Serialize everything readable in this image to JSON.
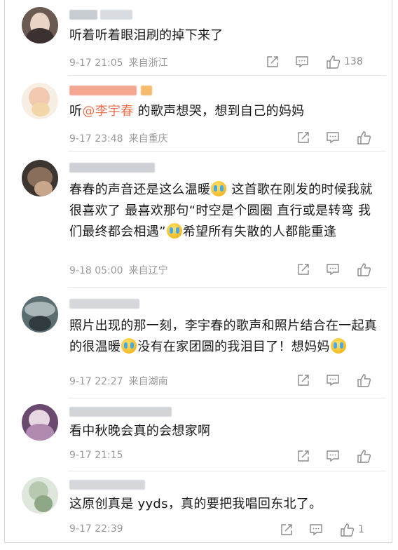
{
  "comments": [
    {
      "text_parts": [
        "听着听着眼泪刷的掉下来了"
      ],
      "date": "9-17 21:05",
      "location": "来自浙江",
      "likes": "138"
    },
    {
      "text_prefix": "听",
      "mention": "@李宇春",
      "text_suffix": " 的歌声想哭，想到自己的妈妈",
      "date": "9-17 23:48",
      "location": "来自重庆",
      "likes": ""
    },
    {
      "text_parts": [
        "春春的声音还是这么温暖",
        " 这首歌在刚发的时候我就很喜欢了 最喜欢那句“时空是个圆圈 直行或是转弯 我们最终都会相遇”",
        "希望所有失散的人都能重逢"
      ],
      "date": "9-18 05:00",
      "location": "来自辽宁",
      "likes": ""
    },
    {
      "text_parts": [
        "照片出现的那一刻，李宇春的歌声和照片结合在一起真的很温暖",
        "没有在家团圆的我泪目了！想妈妈",
        ""
      ],
      "date": "9-17 22:27",
      "location": "来自湖南",
      "likes": ""
    },
    {
      "text_parts": [
        "看中秋晚会真的会想家啊"
      ],
      "date": "9-17 21:15",
      "location": "",
      "likes": ""
    },
    {
      "text_parts": [
        "这原创真是 yyds，真的要把我唱回东北了。"
      ],
      "date": "9-17 22:39",
      "location": "",
      "likes": "1"
    }
  ],
  "icons": {
    "share": "share-icon",
    "comment": "comment-icon",
    "like": "thumbs-up-icon",
    "emoji": "crying-emoji"
  },
  "colors": {
    "mention": "#eb7350",
    "meta": "#9a9a9a",
    "text": "#1a1a1a"
  }
}
